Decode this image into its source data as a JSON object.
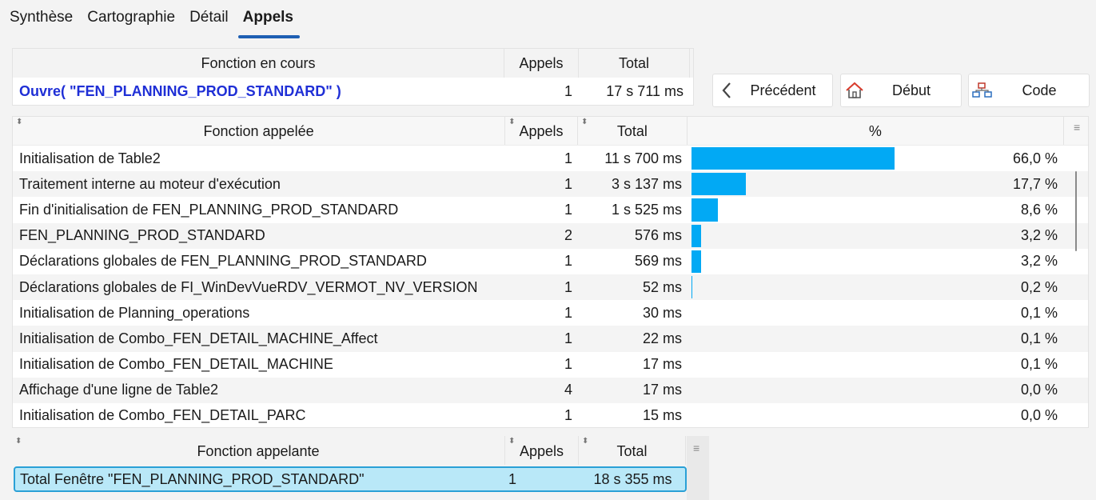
{
  "tabs": [
    {
      "label": "Synthèse",
      "active": false
    },
    {
      "label": "Cartographie",
      "active": false
    },
    {
      "label": "Détail",
      "active": false
    },
    {
      "label": "Appels",
      "active": true
    }
  ],
  "current": {
    "headers": {
      "name": "Fonction en cours",
      "calls": "Appels",
      "total": "Total"
    },
    "name": "Ouvre( \"FEN_PLANNING_PROD_STANDARD\" )",
    "calls": "1",
    "total": "17 s 711 ms"
  },
  "buttons": {
    "previous": "Précédent",
    "start": "Début",
    "code": "Code"
  },
  "called": {
    "headers": {
      "name": "Fonction appelée",
      "calls": "Appels",
      "total": "Total",
      "percent": "%"
    },
    "bar_color": "#02a9f4",
    "rows": [
      {
        "name": "Initialisation de Table2",
        "calls": "1",
        "total": "11 s 700 ms",
        "pct_value": 66.0,
        "pct": "66,0 %"
      },
      {
        "name": "Traitement interne au moteur d'exécution",
        "calls": "1",
        "total": "3 s 137 ms",
        "pct_value": 17.7,
        "pct": "17,7 %"
      },
      {
        "name": "Fin d'initialisation de FEN_PLANNING_PROD_STANDARD",
        "calls": "1",
        "total": "1 s 525 ms",
        "pct_value": 8.6,
        "pct": "8,6 %"
      },
      {
        "name": "FEN_PLANNING_PROD_STANDARD",
        "calls": "2",
        "total": "576 ms",
        "pct_value": 3.2,
        "pct": "3,2 %"
      },
      {
        "name": "Déclarations globales de FEN_PLANNING_PROD_STANDARD",
        "calls": "1",
        "total": "569 ms",
        "pct_value": 3.2,
        "pct": "3,2 %"
      },
      {
        "name": "Déclarations globales de FI_WinDevVueRDV_VERMOT_NV_VERSION",
        "calls": "1",
        "total": "52 ms",
        "pct_value": 0.2,
        "pct": "0,2 %"
      },
      {
        "name": "Initialisation de Planning_operations",
        "calls": "1",
        "total": "30 ms",
        "pct_value": 0.1,
        "pct": "0,1 %"
      },
      {
        "name": "Initialisation de Combo_FEN_DETAIL_MACHINE_Affect",
        "calls": "1",
        "total": "22 ms",
        "pct_value": 0.1,
        "pct": "0,1 %"
      },
      {
        "name": "Initialisation de Combo_FEN_DETAIL_MACHINE",
        "calls": "1",
        "total": "17 ms",
        "pct_value": 0.1,
        "pct": "0,1 %"
      },
      {
        "name": "Affichage d'une ligne de Table2",
        "calls": "4",
        "total": "17 ms",
        "pct_value": 0.0,
        "pct": "0,0 %"
      },
      {
        "name": "Initialisation de Combo_FEN_DETAIL_PARC",
        "calls": "1",
        "total": "15 ms",
        "pct_value": 0.0,
        "pct": "0,0 %"
      }
    ]
  },
  "caller": {
    "headers": {
      "name": "Fonction appelante",
      "calls": "Appels",
      "total": "Total"
    },
    "rows": [
      {
        "name": "Total Fenêtre \"FEN_PLANNING_PROD_STANDARD\"",
        "calls": "1",
        "total": "18 s 355 ms"
      }
    ]
  }
}
